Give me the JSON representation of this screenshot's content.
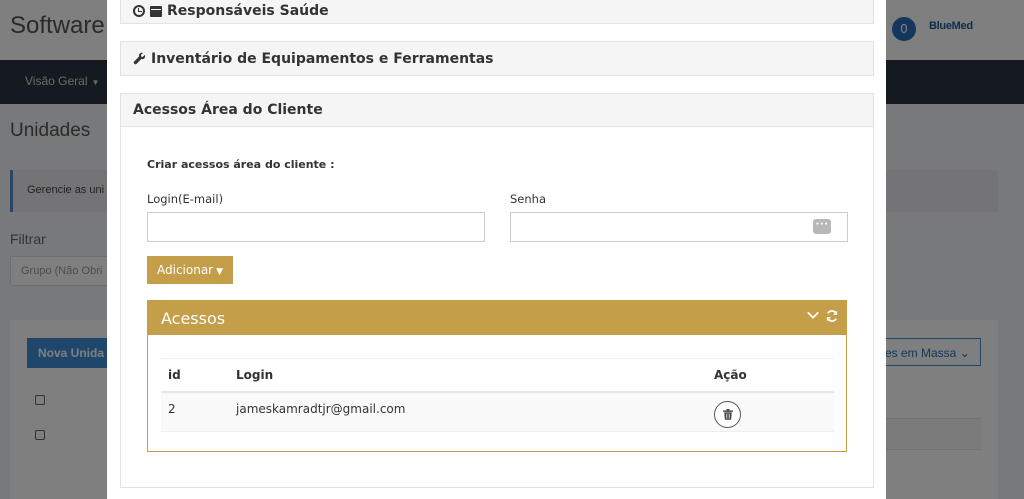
{
  "background": {
    "app_title": "Software",
    "notification_count": "0",
    "logo_text": "BlueMed",
    "nav_item": "Visão Geral",
    "section_title": "Unidades",
    "info_text": "Gerencie as uni",
    "filter_label": "Filtrar",
    "filter_placeholder": "Grupo (Não Obri",
    "new_button": "Nova Unida",
    "mass_button": "es em Massa"
  },
  "modal": {
    "panels": [
      {
        "title": "Responsáveis Saúde",
        "icons": [
          "clock-icon",
          "archive-icon"
        ]
      },
      {
        "title": "Inventário de Equipamentos e Ferramentas",
        "icons": [
          "wrench-icon"
        ]
      },
      {
        "title": "Acessos Área do Cliente"
      }
    ],
    "create_title": "Criar acessos área do cliente :",
    "login_label": "Login(E-mail)",
    "login_value": "",
    "password_label": "Senha",
    "password_value": "",
    "password_toggle_icon": "password-dots-icon",
    "add_button": "Adicionar",
    "accesses": {
      "title": "Acessos",
      "header_icons": [
        "chevron-down-icon",
        "refresh-icon"
      ],
      "columns": [
        "id",
        "Login",
        "Ação"
      ],
      "rows": [
        {
          "id": "2",
          "login": "jameskamradtjr@gmail.com",
          "action_icon": "trash-icon"
        }
      ]
    }
  },
  "colors": {
    "accent_gold": "#c49e48",
    "overlay": "rgba(0,0,0,0.5)",
    "nav_dark": "#2b3341",
    "primary_blue": "#3d8fd6"
  }
}
